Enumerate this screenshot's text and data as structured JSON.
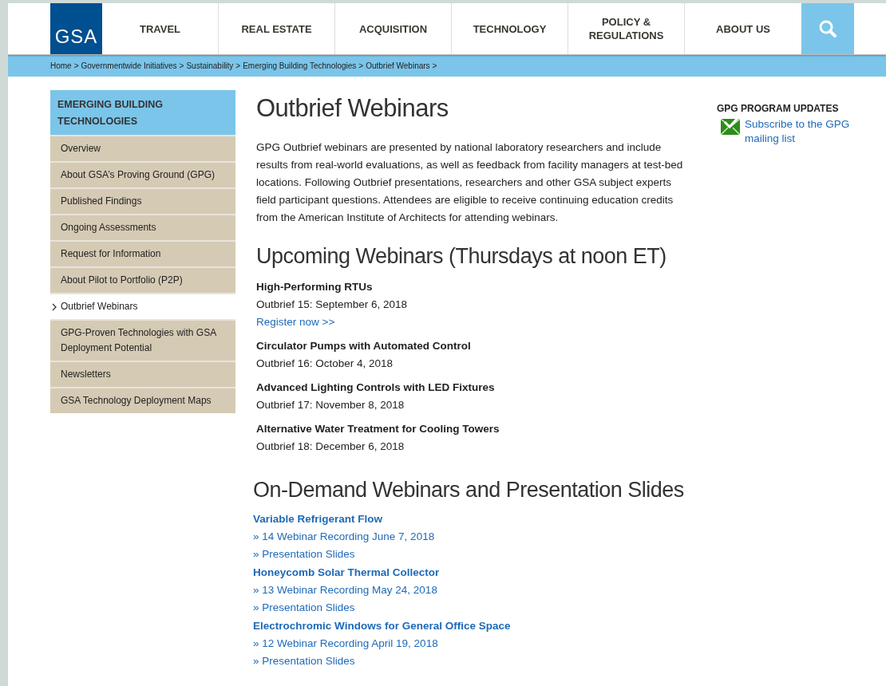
{
  "header": {
    "logo": "GSA",
    "nav": [
      "TRAVEL",
      "REAL ESTATE",
      "ACQUISITION",
      "TECHNOLOGY",
      "POLICY & REGULATIONS",
      "ABOUT US"
    ]
  },
  "breadcrumb": [
    {
      "label": "Home",
      "separator": ">"
    },
    {
      "label": "Governmentwide Initiatives",
      "separator": ">"
    },
    {
      "label": "Sustainability",
      "separator": ">"
    },
    {
      "label": "Emerging Building Technologies",
      "separator": ">"
    },
    {
      "label": "Outbrief Webinars",
      "separator": ">"
    }
  ],
  "sidebar": {
    "title": "EMERGING BUILDING TECHNOLOGIES",
    "items": [
      {
        "label": "Overview",
        "selected": false
      },
      {
        "label": "About GSA’s Proving Ground (GPG)",
        "selected": false
      },
      {
        "label": "Published Findings",
        "selected": false
      },
      {
        "label": "Ongoing Assessments",
        "selected": false
      },
      {
        "label": "Request for Information",
        "selected": false
      },
      {
        "label": "About Pilot to Portfolio (P2P)",
        "selected": false
      },
      {
        "label": "Outbrief Webinars",
        "selected": true
      },
      {
        "label": "GPG-Proven Technologies with GSA Deployment Potential",
        "selected": false
      },
      {
        "label": "Newsletters",
        "selected": false
      },
      {
        "label": "GSA Technology Deployment Maps",
        "selected": false
      }
    ]
  },
  "main": {
    "title": "Outbrief Webinars",
    "intro": "GPG Outbrief webinars are presented by national laboratory researchers and include results from real-world evaluations, as well as feedback from facility managers at test-bed locations. Following Outbrief presentations, researchers and other GSA subject experts field participant questions. Attendees are eligible to receive continuing education credits from the American Institute of Architects for attending webinars.",
    "upcoming_heading": "Upcoming Webinars (Thursdays at noon ET)",
    "upcoming": [
      {
        "title": "High-Performing RTUs",
        "date": "Outbrief 15: September 6, 2018",
        "link": "Register now >>"
      },
      {
        "title": "Circulator Pumps with Automated Control",
        "date": "Outbrief 16: October 4, 2018"
      },
      {
        "title": "Advanced Lighting Controls with LED Fixtures",
        "date": "Outbrief 17: November 8, 2018"
      },
      {
        "title": "Alternative Water Treatment for Cooling Towers",
        "date": "Outbrief 18: December 6, 2018"
      }
    ],
    "ondemand_heading": "On-Demand Webinars and Presentation Slides",
    "ondemand": [
      {
        "title": "Variable Refrigerant Flow",
        "links": [
          "» 14 Webinar Recording June 7, 2018",
          "» Presentation Slides"
        ]
      },
      {
        "title": "Honeycomb Solar Thermal Collector",
        "links": [
          "» 13 Webinar Recording May 24, 2018",
          "» Presentation Slides"
        ]
      },
      {
        "title": "Electrochromic Windows for General Office Space",
        "links": [
          "» 12 Webinar Recording April 19, 2018",
          "» Presentation Slides"
        ]
      }
    ]
  },
  "aside": {
    "heading": "GPG PROGRAM UPDATES",
    "link": "Subscribe to the GPG mailing list"
  }
}
